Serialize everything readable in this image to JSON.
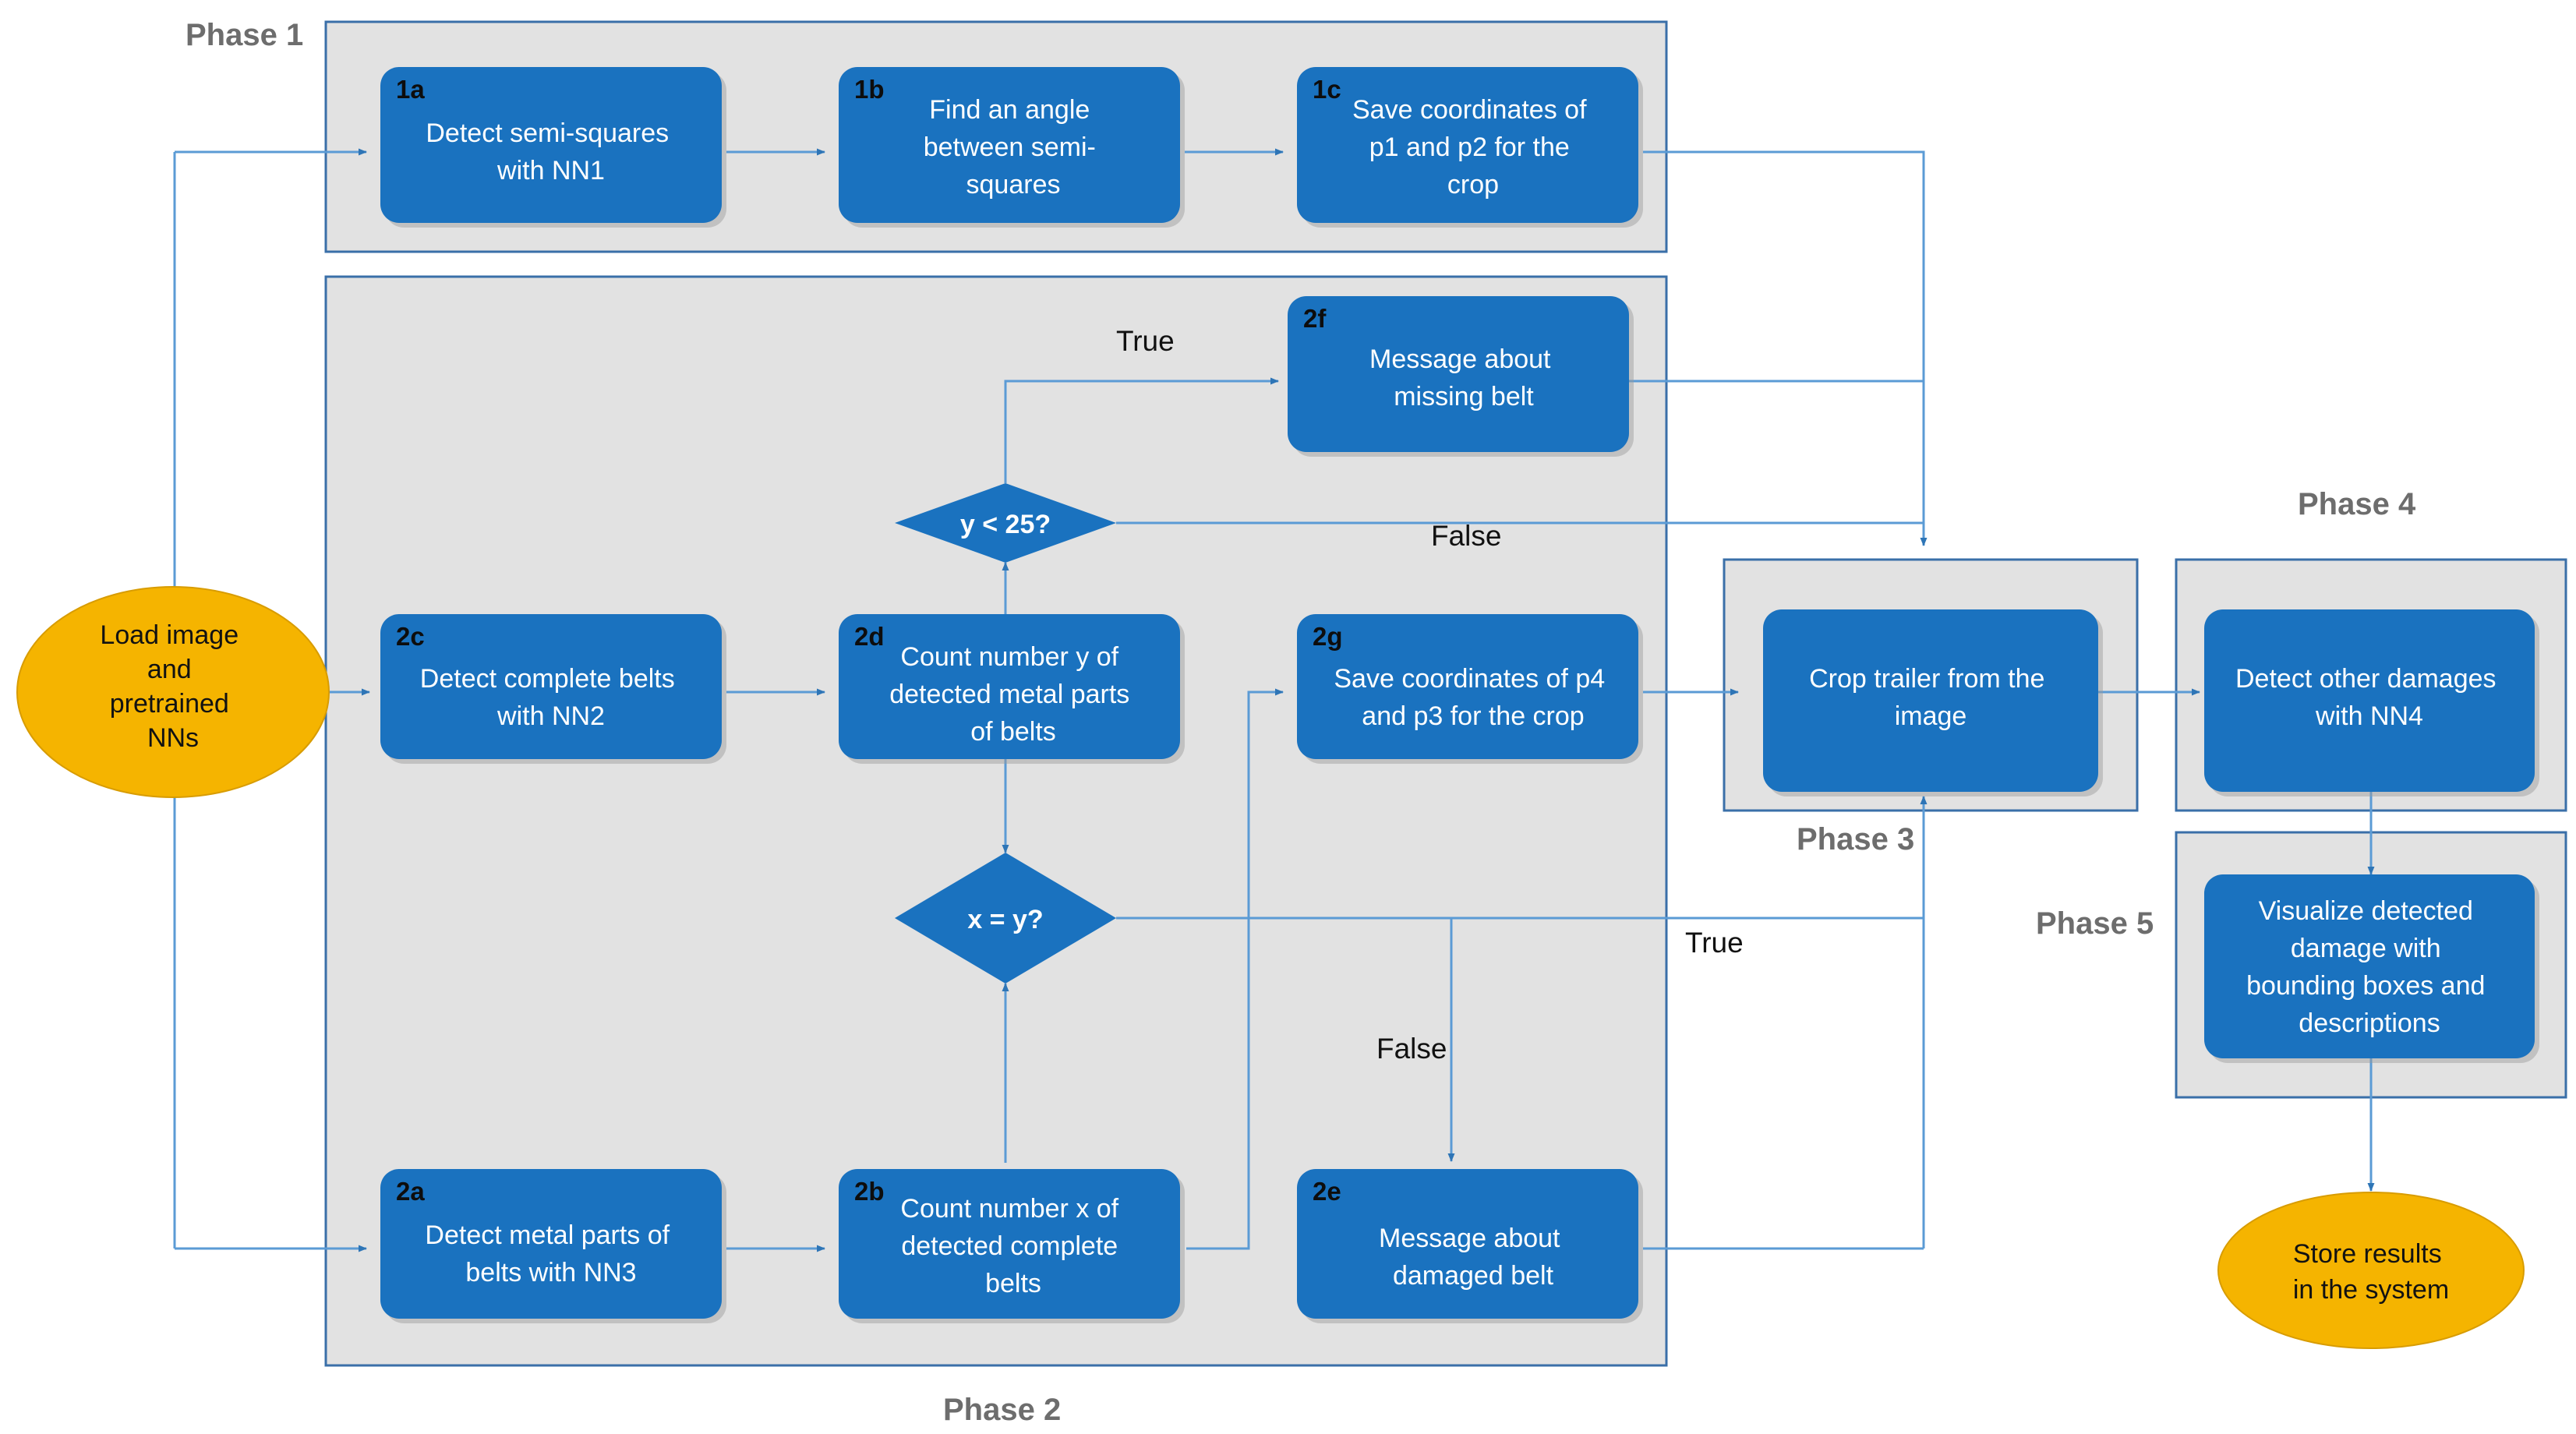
{
  "diagram": {
    "title": "Trailer belt damage detection pipeline flowchart",
    "colors": {
      "process_fill": "#1a72bf",
      "process_text": "#ffffff",
      "terminator_fill": "#f5b400",
      "phase_band_fill": "#e2e2e2",
      "phase_band_stroke": "#3a6fa8",
      "connector": "#5b9bd5",
      "phase_label": "#6d6d6d"
    },
    "phases": [
      {
        "id": "phase1",
        "label": "Phase 1"
      },
      {
        "id": "phase2",
        "label": "Phase 2"
      },
      {
        "id": "phase3",
        "label": "Phase 3"
      },
      {
        "id": "phase4",
        "label": "Phase 4"
      },
      {
        "id": "phase5",
        "label": "Phase 5"
      }
    ],
    "terminators": [
      {
        "id": "start",
        "text_lines": [
          "Load image",
          "and",
          "pretrained",
          "NNs"
        ]
      },
      {
        "id": "end",
        "text_lines": [
          "Store results",
          "in the system"
        ]
      }
    ],
    "nodes": [
      {
        "id": "1a",
        "tag": "1a",
        "phase": "phase1",
        "text_lines": [
          "Detect semi-squares",
          "with NN1"
        ]
      },
      {
        "id": "1b",
        "tag": "1b",
        "phase": "phase1",
        "text_lines": [
          "Find an angle",
          "between semi-",
          "squares"
        ]
      },
      {
        "id": "1c",
        "tag": "1c",
        "phase": "phase1",
        "text_lines": [
          "Save coordinates of",
          "p1 and p2 for the",
          "crop"
        ]
      },
      {
        "id": "2f",
        "tag": "2f",
        "phase": "phase2",
        "text_lines": [
          "Message about",
          "missing belt"
        ]
      },
      {
        "id": "2c",
        "tag": "2c",
        "phase": "phase2",
        "text_lines": [
          "Detect complete belts",
          "with NN2"
        ]
      },
      {
        "id": "2d",
        "tag": "2d",
        "phase": "phase2",
        "text_lines": [
          "Count number y of",
          "detected metal parts",
          "of belts"
        ],
        "bold_tokens": [
          "y"
        ]
      },
      {
        "id": "2g",
        "tag": "2g",
        "phase": "phase2",
        "text_lines": [
          "Save coordinates of p4",
          "and p3 for the crop"
        ]
      },
      {
        "id": "2a",
        "tag": "2a",
        "phase": "phase2",
        "text_lines": [
          "Detect metal parts of",
          "belts with NN3"
        ]
      },
      {
        "id": "2b",
        "tag": "2b",
        "phase": "phase2",
        "text_lines": [
          "Count number x of",
          "detected complete",
          "belts"
        ],
        "bold_tokens": [
          "x"
        ]
      },
      {
        "id": "2e",
        "tag": "2e",
        "phase": "phase2",
        "text_lines": [
          "Message about",
          "damaged belt"
        ]
      },
      {
        "id": "crop",
        "tag": "",
        "phase": "phase3",
        "text_lines": [
          "Crop trailer from the",
          "image"
        ]
      },
      {
        "id": "nn4",
        "tag": "",
        "phase": "phase4",
        "text_lines": [
          "Detect other damages",
          "with NN4"
        ]
      },
      {
        "id": "viz",
        "tag": "",
        "phase": "phase5",
        "text_lines": [
          "Visualize detected",
          "damage with",
          "bounding boxes and",
          "descriptions"
        ]
      }
    ],
    "decisions": [
      {
        "id": "d_y25",
        "text": "y < 25?",
        "phase": "phase2"
      },
      {
        "id": "d_xy",
        "text": "x = y?",
        "phase": "phase2"
      }
    ],
    "edge_labels": [
      {
        "id": "true_y25",
        "text": "True"
      },
      {
        "id": "false_y25",
        "text": "False"
      },
      {
        "id": "true_xy",
        "text": "True"
      },
      {
        "id": "false_xy",
        "text": "False"
      }
    ]
  }
}
